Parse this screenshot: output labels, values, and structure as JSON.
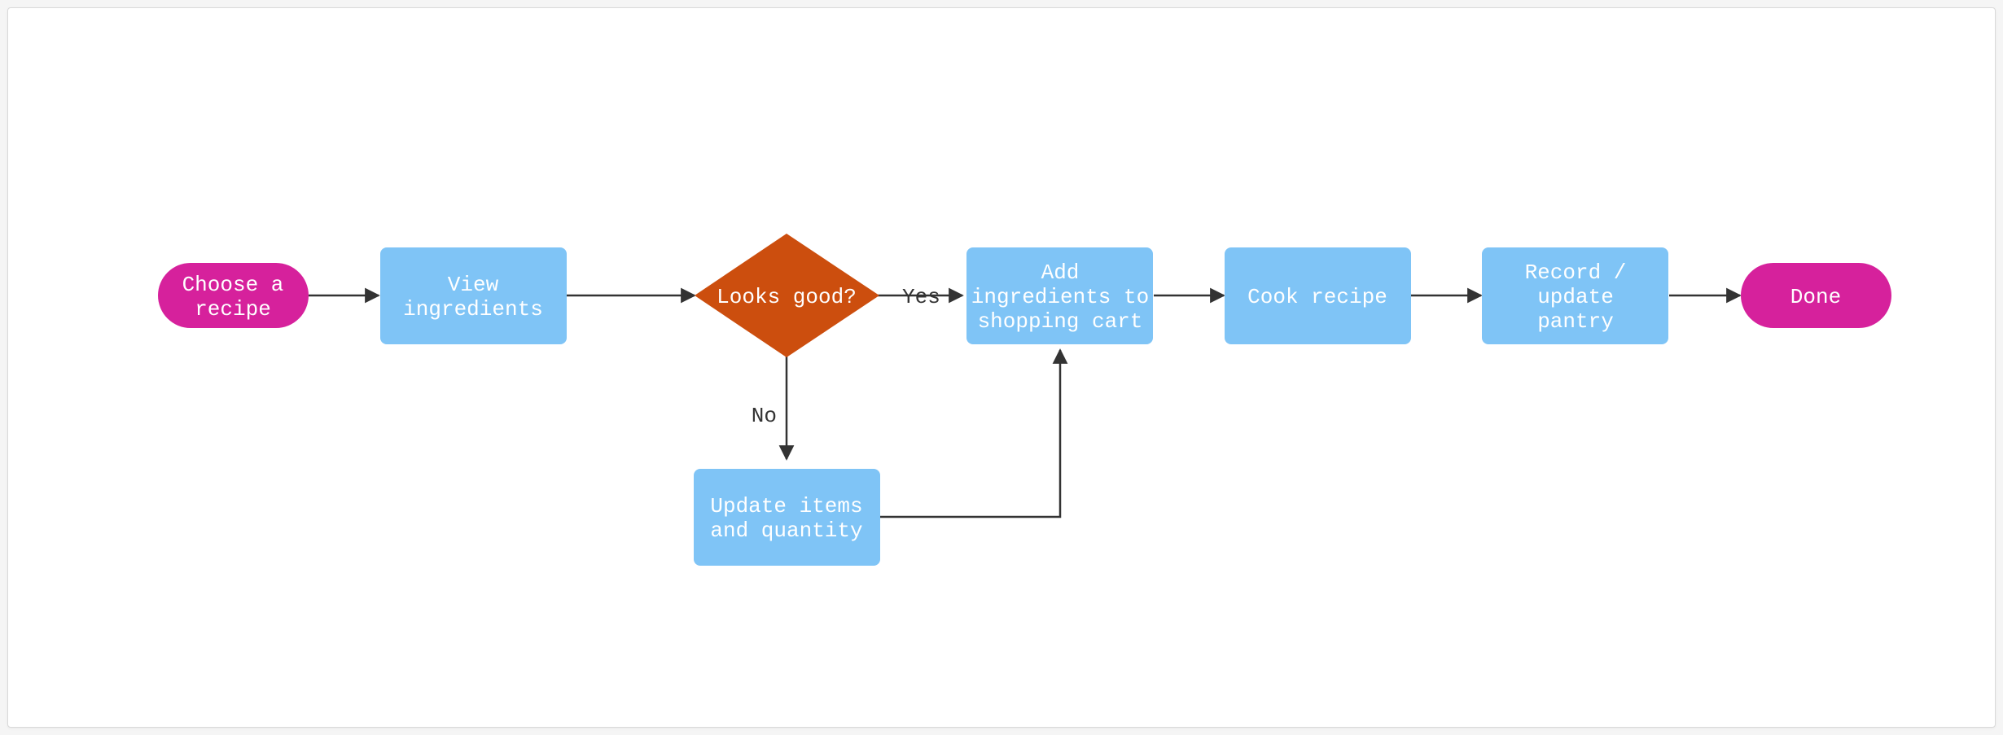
{
  "colors": {
    "terminator_fill": "#d6219c",
    "process_fill": "#7fc4f6",
    "decision_fill": "#cc4e0e",
    "stroke": "#333333"
  },
  "nodes": {
    "start": {
      "label": "Choose a recipe"
    },
    "view": {
      "label1": "View",
      "label2": "ingredients"
    },
    "decision": {
      "label": "Looks good?"
    },
    "add": {
      "label1": "Add",
      "label2": "ingredients to",
      "label3": "shopping cart"
    },
    "update": {
      "label1": "Update items",
      "label2": "and quantity"
    },
    "cook": {
      "label": "Cook recipe"
    },
    "record": {
      "label1": "Record /",
      "label2": "update",
      "label3": "pantry"
    },
    "done": {
      "label": "Done"
    }
  },
  "edges": {
    "yes": "Yes",
    "no": "No"
  }
}
